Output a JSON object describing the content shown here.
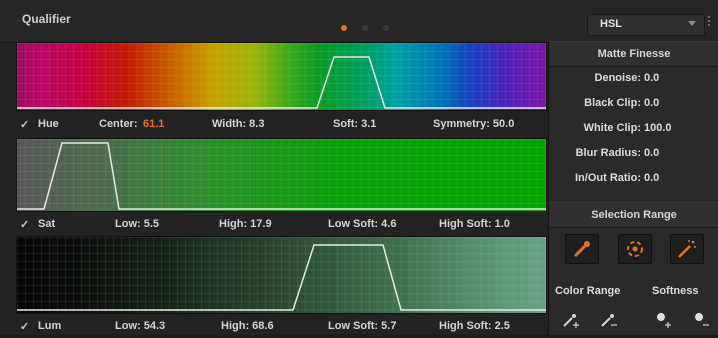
{
  "header": {
    "title": "Qualifier",
    "page_dots": 3,
    "active_dot": 0,
    "mode": "HSL"
  },
  "hue": {
    "check": "✓",
    "label": "Hue",
    "center_label": "Center:",
    "center_value": "61.1",
    "width": "Width: 8.3",
    "soft": "Soft: 3.1",
    "symmetry": "Symmetry: 50.0"
  },
  "sat": {
    "check": "✓",
    "label": "Sat",
    "low": "Low: 5.5",
    "high": "High: 17.9",
    "low_soft": "Low Soft: 4.6",
    "high_soft": "High Soft: 1.0"
  },
  "lum": {
    "check": "✓",
    "label": "Lum",
    "low": "Low: 54.3",
    "high": "High: 68.6",
    "low_soft": "Low Soft: 5.7",
    "high_soft": "High Soft: 2.5"
  },
  "matte_finesse": {
    "title": "Matte Finesse",
    "rows": [
      {
        "label": "Denoise:",
        "value": "0.0"
      },
      {
        "label": "Black Clip:",
        "value": "0.0"
      },
      {
        "label": "White Clip:",
        "value": "100.0"
      },
      {
        "label": "Blur Radius:",
        "value": "0.0"
      },
      {
        "label": "In/Out Ratio:",
        "value": "0.0"
      }
    ]
  },
  "selection_range": {
    "title": "Selection Range",
    "tools": [
      "picker-icon",
      "cursor-select-icon",
      "magic-wand-icon"
    ],
    "color_range": "Color Range",
    "softness": "Softness",
    "pickers": [
      "picker-plus-icon",
      "picker-minus-icon",
      "softness-plus-icon",
      "softness-minus-icon"
    ]
  },
  "colors": {
    "accent": "#e4702d",
    "curve": "#e8e8e8"
  }
}
